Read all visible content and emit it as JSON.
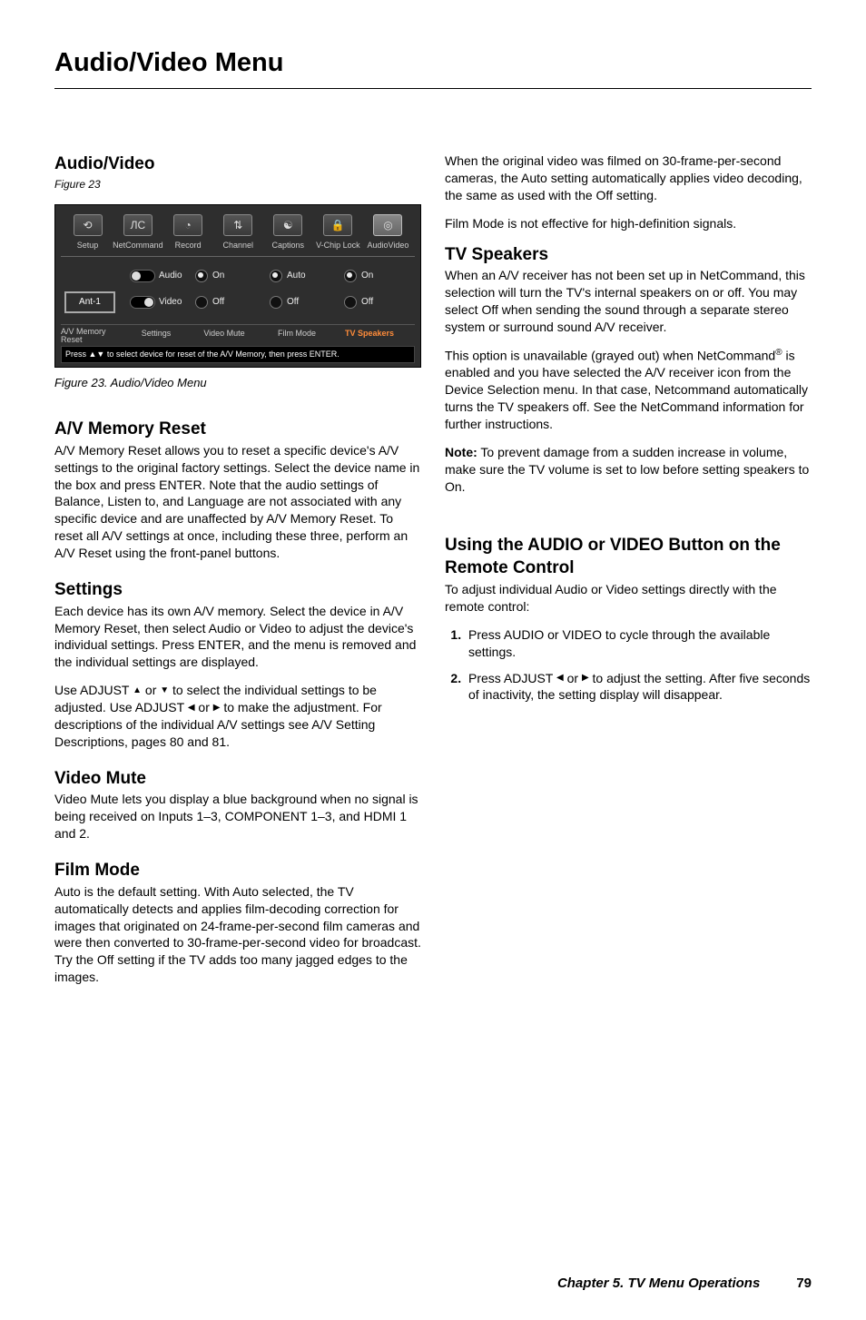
{
  "title": "Audio/Video Menu",
  "left": {
    "h_av": "Audio/Video",
    "figref": "Figure 23",
    "caption": "Figure 23.  Audio/Video Menu",
    "h_mem": "A/V Memory Reset",
    "p_mem": "A/V Memory Reset allows you to reset a specific device's A/V settings to the original factory settings.  Select the device name in the box and press ENTER.  Note that the audio settings of Balance, Listen to, and Language are not associated with any specific device and are unaffected by A/V Memory Reset.  To reset all A/V settings at once, including these three, perform an A/V Reset using the  front-panel buttons.",
    "h_set": "Settings",
    "p_set1": "Each device has its own A/V memory.  Select the device in A/V Memory Reset, then select Audio or Video to adjust the device's individual settings.  Press ENTER, and the menu is removed and the individual settings are displayed.",
    "p_set2a": "Use ADJUST ",
    "p_set2b": " or ",
    "p_set2c": " to select the individual settings to be adjusted.  Use ADJUST ",
    "p_set2d": " or ",
    "p_set2e": " to make the adjustment.  For descriptions of the individual A/V settings see A/V Setting Descriptions, pages 80 and 81.",
    "h_vm": "Video Mute",
    "p_vm": "Video Mute lets you display a blue background when no signal is being received on Inputs 1–3, COMPONENT 1–3, and HDMI 1 and 2.",
    "h_fm": "Film Mode",
    "p_fm": "Auto is the default setting.  With Auto selected, the TV automatically detects and applies film-decoding correction for images that originated on 24-frame-per-second film cameras and were then converted to 30-frame-per-second video for broadcast.  Try the Off setting if the TV adds too many jagged edges to the images."
  },
  "right": {
    "p_fm2": "When the original video was filmed on 30-frame-per-second cameras, the Auto setting automatically applies video decoding, the same as used with the Off setting.",
    "p_fm3": "Film Mode is not effective for high-definition signals.",
    "h_tvs": "TV Speakers",
    "p_tvs1": "When an A/V receiver has not been set up in NetCommand, this selection will turn the TV's internal speakers on or off.  You may select Off when sending the sound through a separate stereo system or surround sound A/V receiver.",
    "p_tvs2a": "This option is unavailable (grayed out) when NetCommand",
    "p_tvs2b": " is enabled and you have selected the A/V receiver icon from the Device Selection menu.  In that case, Netcommand automatically turns the TV speakers off.  See the NetCommand information for further instructions.",
    "note_label": "Note:",
    "p_note": "  To prevent damage from a sudden increase in volume, make sure the TV volume is set to low before setting speakers to On.",
    "h_use": "Using the AUDIO or VIDEO Button on the Remote Control",
    "p_use": "To adjust individual Audio or Video settings directly with the remote control:",
    "li1": "Press AUDIO or VIDEO to cycle through the available settings.",
    "li2a": "Press ADJUST ",
    "li2b": " or ",
    "li2c": " to adjust the setting.  After five seconds of inactivity, the setting display will disappear."
  },
  "figure": {
    "icons": [
      "Setup",
      "NetCommand",
      "Record",
      "Channel",
      "Captions",
      "V-Chip Lock",
      "AudioVideo"
    ],
    "ant": "Ant-1",
    "slider_audio": "Audio",
    "slider_video": "Video",
    "vm_on": "On",
    "vm_off": "Off",
    "fm_auto": "Auto",
    "fm_off": "Off",
    "sp_on": "On",
    "sp_off": "Off",
    "lab_mem": "A/V Memory Reset",
    "lab_set": "Settings",
    "lab_vm": "Video Mute",
    "lab_fm": "Film Mode",
    "lab_sp": "TV Speakers",
    "hint": "Press ▲▼ to select device for reset of the A/V Memory, then press ENTER."
  },
  "footer": {
    "chapter": "Chapter 5. TV Menu Operations",
    "page": "79"
  }
}
